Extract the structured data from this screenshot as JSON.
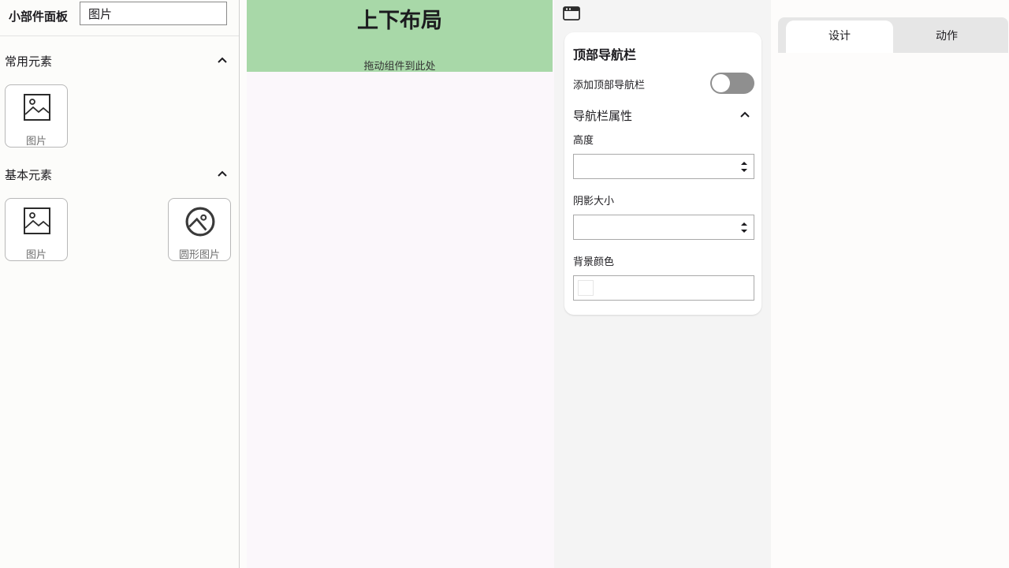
{
  "left_panel": {
    "title": "小部件面板",
    "search_value": "图片",
    "sections": [
      {
        "label": "常用元素",
        "expanded": true,
        "icon": "chevron-up-icon",
        "items": [
          {
            "label": "图片",
            "icon": "image-icon"
          }
        ]
      },
      {
        "label": "基本元素",
        "expanded": true,
        "icon": "chevron-up-icon",
        "items": [
          {
            "label": "图片",
            "icon": "image-icon"
          },
          {
            "label": "圆形图片",
            "icon": "circle-image-icon"
          }
        ]
      }
    ]
  },
  "canvas": {
    "title": "上下布局",
    "drop_hint": "拖动组件到此处",
    "top_color": "#a8d8a8",
    "body_color": "#fbf7fb"
  },
  "properties": {
    "toolbar_icon": "window-icon",
    "card_title": "顶部导航栏",
    "toggle_label": "添加顶部导航栏",
    "toggle_on": false,
    "group_title": "导航栏属性",
    "fields": [
      {
        "label": "高度",
        "value": ""
      },
      {
        "label": "阴影大小",
        "value": ""
      },
      {
        "label": "背景颜色",
        "value": ""
      }
    ]
  },
  "right_panel": {
    "tabs": [
      {
        "label": "设计",
        "active": true
      },
      {
        "label": "动作",
        "active": false
      }
    ]
  }
}
